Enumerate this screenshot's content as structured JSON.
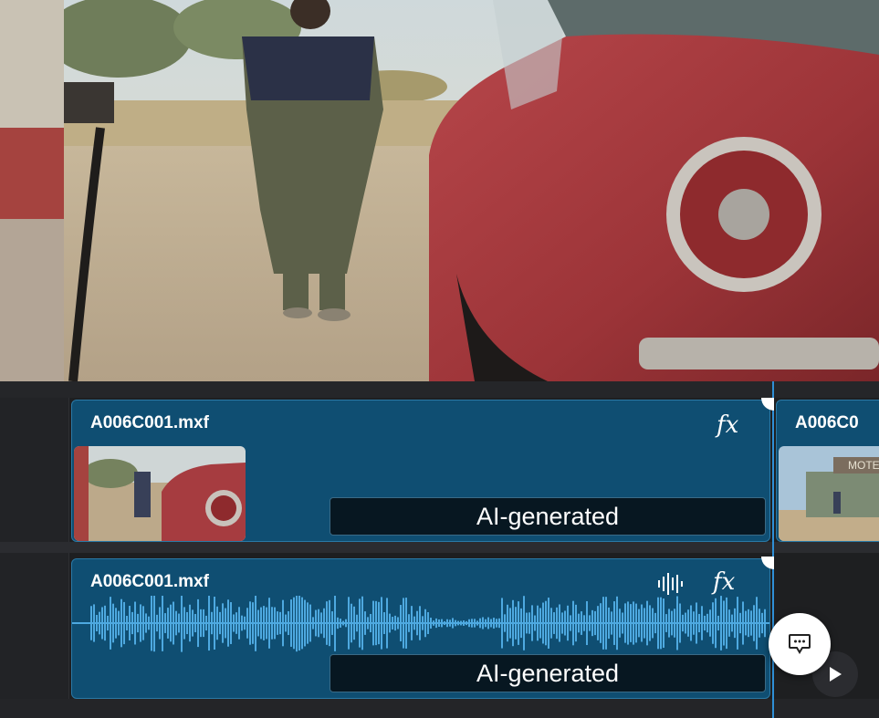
{
  "viewer": {
    "content": "video-frame"
  },
  "timeline": {
    "video_track": {
      "clip_name": "A006C001.mxf",
      "fx_label": "fx",
      "ai_label": "AI-generated",
      "next_clip_name": "A006C0",
      "next_thumb_sign": "MOTE"
    },
    "audio_track": {
      "clip_name": "A006C001.mxf",
      "fx_label": "fx",
      "ai_label": "AI-generated"
    }
  },
  "controls": {
    "chat_icon": "chat-icon",
    "play_icon": "play-icon"
  },
  "colors": {
    "clip_bg": "#0f4e72",
    "waveform": "#4ea9e0",
    "playhead": "#2f8fd6"
  }
}
